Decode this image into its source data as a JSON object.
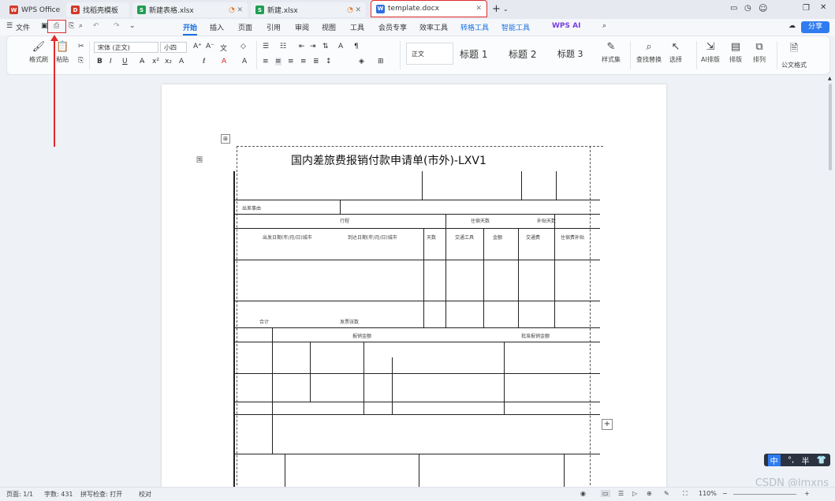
{
  "tabs": [
    {
      "label": "WPS Office",
      "color": "#d23a2a",
      "ico": "W"
    },
    {
      "label": "找稻壳模板",
      "color": "#d23a2a",
      "ico": "D"
    },
    {
      "label": "新建表格.xlsx",
      "color": "#1f9e52",
      "ico": "S"
    },
    {
      "label": "新建.xlsx",
      "color": "#1f9e52",
      "ico": "S"
    },
    {
      "label": "template.docx",
      "color": "#2f6fe0",
      "ico": "W"
    }
  ],
  "menu": {
    "file": "文件",
    "items": [
      "开始",
      "插入",
      "页面",
      "引用",
      "审阅",
      "视图",
      "工具",
      "会员专享",
      "效率工具",
      "转格工具",
      "智能工具",
      "WPS AI"
    ],
    "share": "分享"
  },
  "ribbon": {
    "format_painter": "格式刷",
    "paste": "粘贴",
    "font": "宋体 (正文)",
    "size": "小四",
    "style_normal": "正文",
    "style_h1": "标题 1",
    "style_h2": "标题 2",
    "style_h3": "标题 3",
    "styles": "样式集",
    "find_replace": "查找替换",
    "select": "选择",
    "ai_layout": "AI排版",
    "layout": "排版",
    "arrange": "排列",
    "formula": "公文格式"
  },
  "doc": {
    "title": "国内差旅费报销付款申请单(市外)-LXV1",
    "prefix": "国",
    "h_traffic": "行程",
    "h_lodging": "住宿天数",
    "h_sub": "补贴天数",
    "col1": "出发日期(年/月/日)城市",
    "col2": "到达日期(年/月/日)城市",
    "col3": "天数",
    "col4": "交通工具",
    "col5": "金额",
    "col6": "交通费",
    "col7": "住宿费补贴",
    "reimb": "报销金额",
    "approval": "批准报销金额",
    "r_total": "合计",
    "invoice": "发票张数",
    "reason": "出差事由"
  },
  "status": {
    "page": "页面: 1/1",
    "words": "字数: 431",
    "spell": "拼写检查: 打开",
    "proof": "校对",
    "zoom": "110%"
  },
  "watermark": "CSDN @lmxns",
  "ime": [
    "中",
    "°,",
    "半",
    "👕"
  ]
}
